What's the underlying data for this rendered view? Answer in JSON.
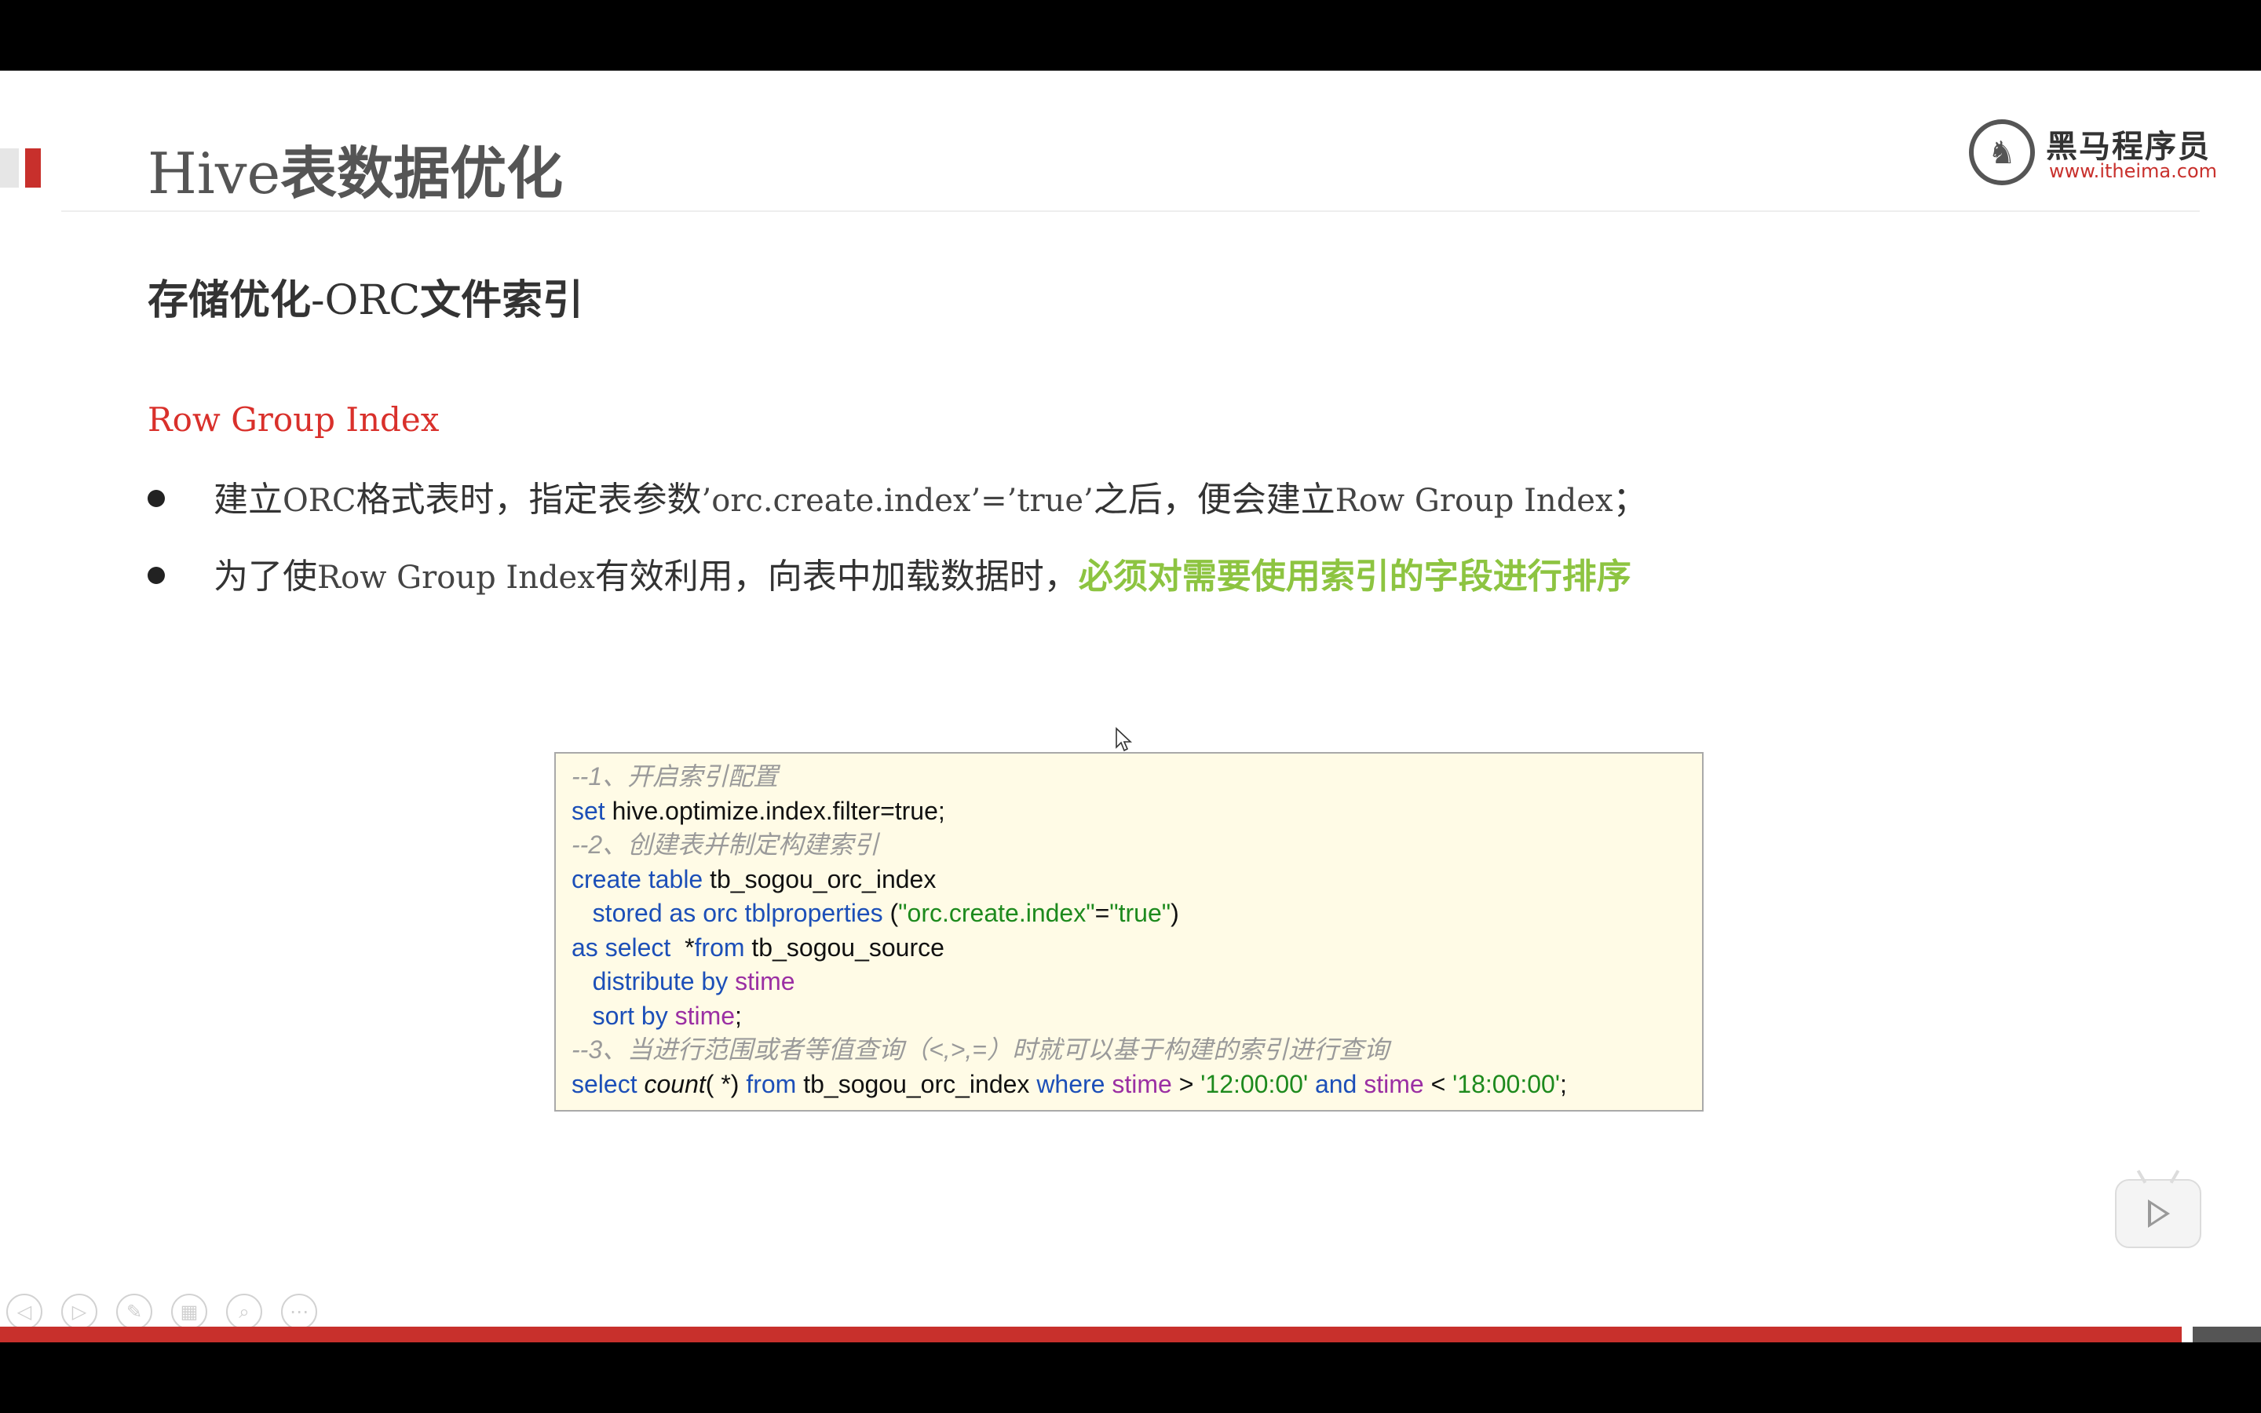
{
  "slide": {
    "title_en": "Hive",
    "title_zh": "表数据优化",
    "subtitle_zh1": "存储优化",
    "subtitle_en": "-ORC",
    "subtitle_zh2": "文件索引",
    "section_label": "Row Group Index",
    "bullets": [
      {
        "p1": "建立",
        "p2": "ORC",
        "p3": "格式表时，指定表参数",
        "p4": "’orc.create.index’=’true’",
        "p5": "之后，便会建立",
        "p6": "Row Group Index",
        "p7": "；"
      },
      {
        "p1": "为了使",
        "p2": "Row Group Index",
        "p3": "有效利用，向表中加载数据时，",
        "highlight": "必须对需要使用索引的字段进行排序"
      }
    ],
    "colors": {
      "accent_red": "#c8302c",
      "label_red": "#d9302b",
      "highlight_green": "#8dc441",
      "keyword_blue": "#1c4fb8",
      "column_purple": "#9b2fa3",
      "string_green": "#1d8a1d",
      "comment_gray": "#9a9a9a"
    }
  },
  "logo": {
    "name": "黑马程序员",
    "url": "www.itheima.com"
  },
  "code": {
    "l1": "--1、开启索引配置",
    "l2_kw": "set",
    "l2_rest": " hive.optimize.index.filter=true;",
    "l3": "--2、创建表并制定构建索引",
    "l4_kw": "create table",
    "l4_rest": " tb_sogou_orc_index",
    "l5_indent": "   ",
    "l5_kw": "stored as orc tblproperties",
    "l5_p1": " (",
    "l5_s1": "\"orc.create.index\"",
    "l5_eq": "=",
    "l5_s2": "\"true\"",
    "l5_p2": ")",
    "l6_kw1": "as select",
    "l6_star": "  *",
    "l6_kw2": "from",
    "l6_rest": " tb_sogou_source",
    "l7_indent": "   ",
    "l7_kw": "distribute by",
    "l7_col": " stime",
    "l8_indent": "   ",
    "l8_kw": "sort by",
    "l8_col": " stime",
    "l8_end": ";",
    "l9": "--3、当进行范围或者等值查询（<,>,=）时就可以基于构建的索引进行查询",
    "l10_kw1": "select",
    "l10_fn": " count",
    "l10_args": "( *)",
    "l10_kw2": " from",
    "l10_tbl": " tb_sogou_orc_index",
    "l10_kw3": " where",
    "l10_col1": " stime",
    "l10_gt": " > ",
    "l10_s1": "'12:00:00'",
    "l10_kw4": " and",
    "l10_col2": " stime",
    "l10_lt": " < ",
    "l10_s2": "'18:00:00'",
    "l10_end": ";"
  },
  "player": {
    "icon": "play-icon"
  },
  "toolbar": {
    "icons": [
      "prev-icon",
      "next-icon",
      "pen-icon",
      "slides-icon",
      "zoom-icon",
      "more-icon"
    ]
  },
  "progress": {
    "fraction": 0.965
  }
}
